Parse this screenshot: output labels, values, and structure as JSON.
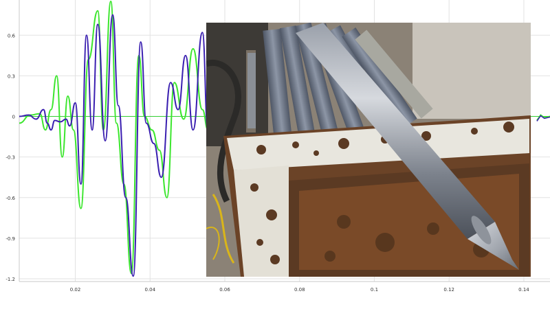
{
  "chart_data": {
    "type": "line",
    "title": "",
    "xlabel": "",
    "ylabel": "",
    "xlim": [
      0.005,
      0.147
    ],
    "ylim": [
      -1.22,
      0.86
    ],
    "x_ticks": [
      0.02,
      0.04,
      0.06,
      0.08,
      0.1,
      0.12,
      0.14
    ],
    "x_tick_labels": [
      "0.02",
      "0.04",
      "0.06",
      "0.08",
      "0.1",
      "0.12",
      "0.14"
    ],
    "y_ticks": [
      0.6,
      0.3,
      0,
      -0.3,
      -0.6,
      -0.9,
      -1.2
    ],
    "y_tick_labels": [
      "0.6",
      "0.3",
      "0",
      "-0.3",
      "-0.6",
      "-0.9",
      "-1.2"
    ],
    "grid": true,
    "zero_line_color": "#32cd32",
    "series": [
      {
        "color": "#3a1fb0",
        "x": [
          0.005,
          0.0075,
          0.0095,
          0.0115,
          0.0125,
          0.0135,
          0.0145,
          0.016,
          0.0175,
          0.0185,
          0.02,
          0.0215,
          0.023,
          0.0245,
          0.026,
          0.028,
          0.03,
          0.0315,
          0.0335,
          0.0355,
          0.0375,
          0.039,
          0.041,
          0.043,
          0.0455,
          0.0475,
          0.0495,
          0.0515,
          0.054,
          0.0555
        ],
        "y": [
          0.0,
          0.01,
          -0.02,
          0.05,
          -0.05,
          -0.1,
          -0.03,
          -0.04,
          -0.02,
          -0.07,
          0.1,
          -0.5,
          0.6,
          -0.1,
          0.68,
          -0.18,
          0.75,
          0.08,
          -0.6,
          -1.18,
          0.55,
          -0.05,
          -0.2,
          -0.45,
          0.25,
          0.05,
          0.45,
          -0.1,
          0.62,
          -0.12
        ]
      },
      {
        "color": "#3ce62e",
        "x": [
          0.005,
          0.008,
          0.0105,
          0.012,
          0.0135,
          0.015,
          0.0165,
          0.018,
          0.0195,
          0.0215,
          0.0235,
          0.026,
          0.0275,
          0.0295,
          0.031,
          0.033,
          0.035,
          0.037,
          0.0385,
          0.0405,
          0.0425,
          0.0445,
          0.0465,
          0.049,
          0.0515,
          0.054,
          0.0555
        ],
        "y": [
          -0.05,
          0.01,
          0.02,
          -0.1,
          0.05,
          0.3,
          -0.3,
          0.15,
          -0.1,
          -0.68,
          0.42,
          0.78,
          -0.1,
          0.85,
          -0.05,
          -0.5,
          -1.16,
          0.45,
          0.0,
          -0.1,
          -0.25,
          -0.6,
          0.25,
          -0.02,
          0.5,
          0.05,
          -0.1
        ]
      }
    ],
    "right_trace_x": [
      0.1435,
      0.1445,
      0.1455,
      0.147
    ],
    "right_trace_y": [
      -0.03,
      0.01,
      -0.01,
      0.0
    ]
  },
  "photo": {
    "subject": "machined steel shaft with conical tip resting on rusty steel frame beside stacked pipes",
    "colors": {
      "sky": "#c9c4bb",
      "frame": "#5b3a23",
      "paint": "#e8e6de",
      "rust": "#7a4a28",
      "steel_light": "#b8bcc4",
      "steel_dark": "#5e6470",
      "pipes": "#6b7383",
      "hose": "#d9b51a"
    }
  }
}
